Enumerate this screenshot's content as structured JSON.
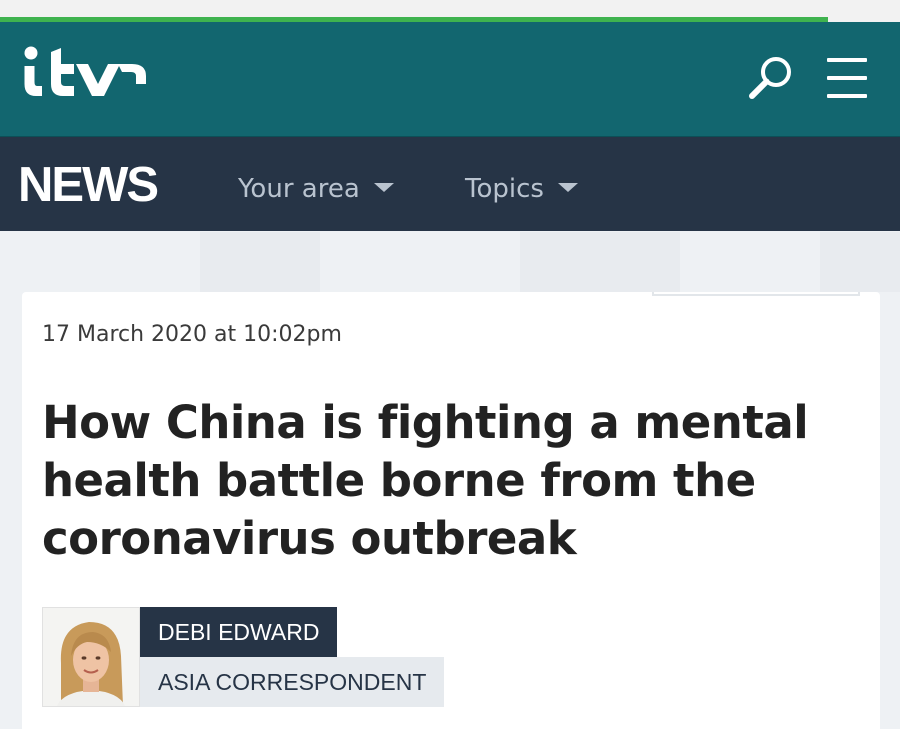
{
  "loading_progress": 0.92,
  "header": {
    "brand": "itv",
    "brand_color": "#12666f",
    "search_icon": "search-icon",
    "menu_icon": "hamburger-menu-icon"
  },
  "news_nav": {
    "section_title": "NEWS",
    "bar_color": "#263446",
    "items": [
      {
        "label": "Your area",
        "icon": "chevron-down-icon"
      },
      {
        "label": "Topics",
        "icon": "chevron-down-icon"
      }
    ]
  },
  "article": {
    "timestamp": "17 March 2020 at 10:02pm",
    "headline": "How China is fighting a mental health battle borne from the coronavirus outbreak",
    "author": {
      "name": "DEBI EDWARD",
      "role": "ASIA CORRESPONDENT"
    }
  },
  "colors": {
    "loading_bar": "#3fb34f",
    "page_background": "#eef1f4"
  }
}
